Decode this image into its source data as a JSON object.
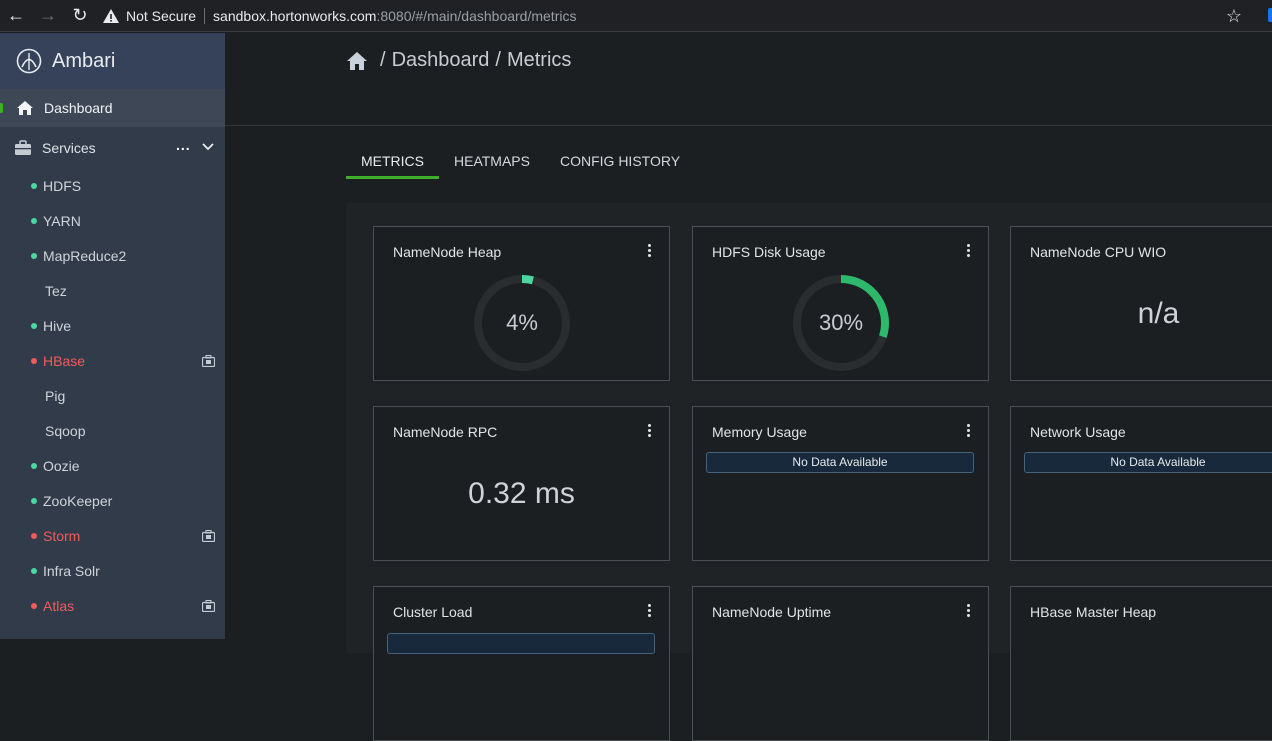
{
  "browser": {
    "security_label": "Not Secure",
    "url_host": "sandbox.hortonworks.com",
    "url_rest": ":8080/#/main/dashboard/metrics"
  },
  "sidebar": {
    "brand": "Ambari",
    "dashboard_label": "Dashboard",
    "services_label": "Services",
    "services_more": "...",
    "services": [
      {
        "name": "HDFS",
        "status": "green",
        "maintenance": false
      },
      {
        "name": "YARN",
        "status": "green",
        "maintenance": false
      },
      {
        "name": "MapReduce2",
        "status": "green",
        "maintenance": false
      },
      {
        "name": "Tez",
        "status": "none",
        "maintenance": false
      },
      {
        "name": "Hive",
        "status": "green",
        "maintenance": false
      },
      {
        "name": "HBase",
        "status": "red",
        "maintenance": true
      },
      {
        "name": "Pig",
        "status": "none",
        "maintenance": false
      },
      {
        "name": "Sqoop",
        "status": "none",
        "maintenance": false
      },
      {
        "name": "Oozie",
        "status": "green",
        "maintenance": false
      },
      {
        "name": "ZooKeeper",
        "status": "green",
        "maintenance": false
      },
      {
        "name": "Storm",
        "status": "red",
        "maintenance": true
      },
      {
        "name": "Infra Solr",
        "status": "green",
        "maintenance": false
      },
      {
        "name": "Atlas",
        "status": "red",
        "maintenance": true
      }
    ]
  },
  "breadcrumb": {
    "sep": "/",
    "dashboard": "Dashboard",
    "metrics": "Metrics"
  },
  "tabs": [
    "METRICS",
    "HEATMAPS",
    "CONFIG HISTORY"
  ],
  "widgets": {
    "namenode_heap": {
      "title": "NameNode Heap",
      "value": "4%",
      "fraction": 0.04
    },
    "hdfs_disk": {
      "title": "HDFS Disk Usage",
      "value": "30%",
      "fraction": 0.3
    },
    "cpu_wio": {
      "title": "NameNode CPU WIO",
      "value": "n/a"
    },
    "rpc": {
      "title": "NameNode RPC",
      "value": "0.32 ms"
    },
    "memory": {
      "title": "Memory Usage",
      "nodata": "No Data Available"
    },
    "network": {
      "title": "Network Usage",
      "nodata": "No Data Available"
    },
    "cluster_load": {
      "title": "Cluster Load"
    },
    "uptime": {
      "title": "NameNode Uptime"
    },
    "hbase_heap": {
      "title": "HBase Master Heap"
    }
  },
  "colors": {
    "heap_arc": "#4dd7a0",
    "disk_arc": "#2eb86b",
    "gauge_track": "#2a2d30",
    "accent": "#3fae2a",
    "alert": "#ef5c5c"
  }
}
